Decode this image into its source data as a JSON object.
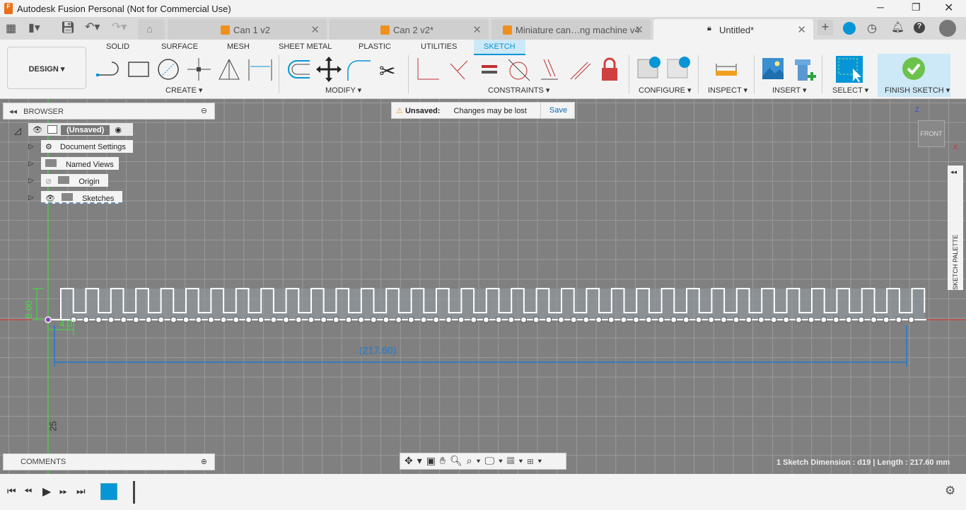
{
  "window": {
    "title": "Autodesk Fusion Personal (Not for Commercial Use)",
    "controls": [
      "minimize",
      "maximize",
      "close"
    ]
  },
  "tabs": [
    {
      "label": "Can 1 v2"
    },
    {
      "label": "Can 2 v2*"
    },
    {
      "label": "Miniature can…ng machine v4"
    },
    {
      "label": "Untitled*",
      "active": true
    }
  ],
  "ribbon": {
    "workspace": "DESIGN",
    "tabs": [
      "SOLID",
      "SURFACE",
      "MESH",
      "SHEET METAL",
      "PLASTIC",
      "UTILITIES",
      "SKETCH"
    ],
    "active_tab": "SKETCH",
    "groups": {
      "create": "CREATE",
      "modify": "MODIFY",
      "constraints": "CONSTRAINTS",
      "configure": "CONFIGURE",
      "inspect": "INSPECT",
      "insert": "INSERT",
      "select": "SELECT",
      "finish": "FINISH SKETCH"
    }
  },
  "browser": {
    "title": "BROWSER",
    "root": "(Unsaved)",
    "items": [
      "Document Settings",
      "Named Views",
      "Origin",
      "Sketches"
    ]
  },
  "unsaved": {
    "label": "Unsaved:",
    "message": "Changes may be lost",
    "save": "Save"
  },
  "viewcube": {
    "face": "FRONT",
    "z": "Z",
    "x": "X"
  },
  "sketch_palette": "SKETCH PALETTE",
  "dimensions": {
    "height": "8.00",
    "width": "4.0",
    "length": "(217.60)",
    "axis_label": "25"
  },
  "comments": "COMMENTS",
  "status": "1 Sketch Dimension : d19 | Length : 217.60 mm",
  "colors": {
    "accent": "#0696d7",
    "finish": "#6cc24a",
    "grid": "#808080",
    "x_axis": "#e03030",
    "y_axis": "#40e040",
    "dimension": "#1e7ad0"
  }
}
